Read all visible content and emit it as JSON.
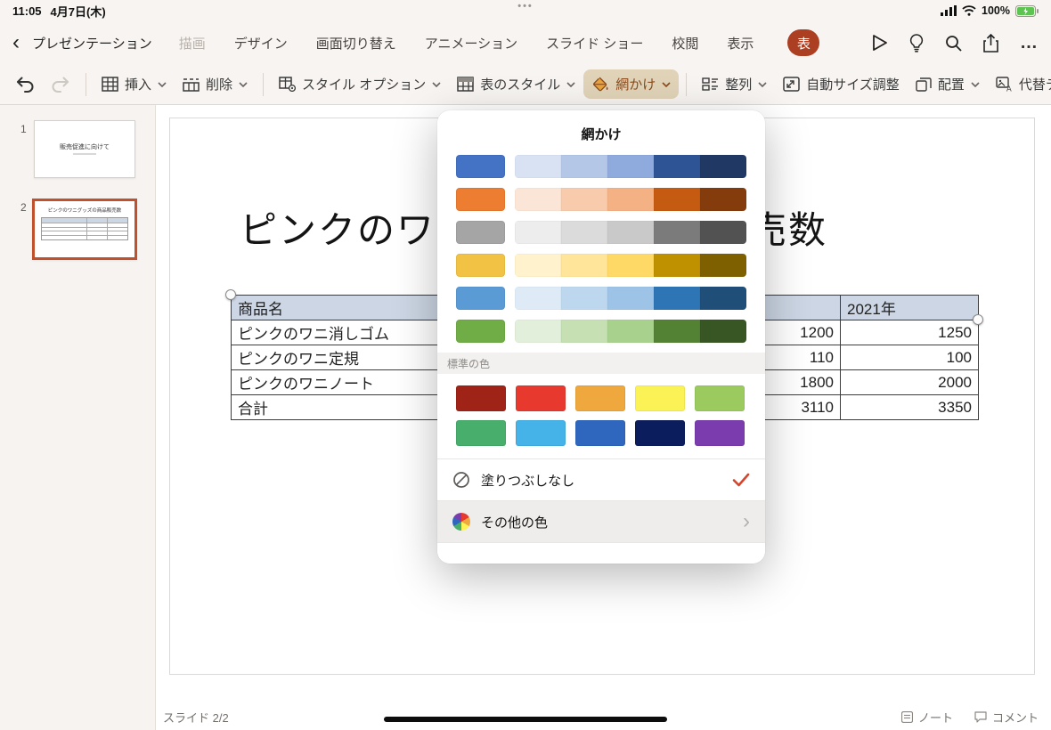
{
  "status": {
    "time": "11:05",
    "date": "4月7日(木)",
    "battery": "100%"
  },
  "titlebar": {
    "doc_title": "プレゼンテーション",
    "tabs": [
      "描画",
      "デザイン",
      "画面切り替え",
      "アニメーション",
      "スライド ショー",
      "校閲",
      "表示"
    ],
    "contextual_tab": "表"
  },
  "toolbar": {
    "insert": "挿入",
    "delete": "削除",
    "style_options": "スタイル オプション",
    "table_styles": "表のスタイル",
    "shading": "網かけ",
    "align": "整列",
    "autofit": "自動サイズ調整",
    "arrange": "配置",
    "alt_text": "代替テキスト"
  },
  "sidebar": {
    "slides": [
      {
        "num": "1",
        "title": "販売促進に向けて"
      },
      {
        "num": "2",
        "title": "ピンクのワニグッズの商品販売数"
      }
    ]
  },
  "slide": {
    "title": "ピンクのワニグッズの商品販売数",
    "table": {
      "headers": [
        "商品名",
        "",
        "2021年"
      ],
      "rows": [
        [
          "ピンクのワニ消しゴム",
          "1200",
          "1250"
        ],
        [
          "ピンクのワニ定規",
          "110",
          "100"
        ],
        [
          "ピンクのワニノート",
          "1800",
          "2000"
        ],
        [
          "合計",
          "3110",
          "3350"
        ]
      ]
    }
  },
  "popup": {
    "title": "網かけ",
    "theme_colors": [
      {
        "main": "#4472C4",
        "tints": [
          "#D9E2F3",
          "#B4C7E7",
          "#8FAADC",
          "#2F5496",
          "#1F3864"
        ]
      },
      {
        "main": "#ED7D31",
        "tints": [
          "#FBE5D6",
          "#F7CBAC",
          "#F4B183",
          "#C55A11",
          "#843C0C"
        ]
      },
      {
        "main": "#A5A5A5",
        "tints": [
          "#EDEDED",
          "#DBDBDB",
          "#C9C9C9",
          "#7B7B7B",
          "#525252"
        ]
      },
      {
        "main": "#F2C245",
        "tints": [
          "#FFF2CC",
          "#FFE599",
          "#FFD966",
          "#BF9000",
          "#7F6000"
        ]
      },
      {
        "main": "#5B9BD5",
        "tints": [
          "#DEEBF7",
          "#BDD7EE",
          "#9DC3E6",
          "#2E75B6",
          "#1F4E79"
        ]
      },
      {
        "main": "#70AD47",
        "tints": [
          "#E2EFDA",
          "#C6E0B4",
          "#A9D18E",
          "#548235",
          "#375623"
        ]
      }
    ],
    "standard_label": "標準の色",
    "standard_colors": [
      [
        "#A02318",
        "#E8392E",
        "#EFA83D",
        "#FBF356",
        "#9BCB5F"
      ],
      [
        "#47AE6C",
        "#45B2E8",
        "#2F66BE",
        "#0B1D5C",
        "#7B3DAD"
      ]
    ],
    "no_fill": "塗りつぶしなし",
    "more_colors": "その他の色",
    "check_color": "#D2452E"
  },
  "footer": {
    "slide_counter": "スライド 2/2",
    "notes": "ノート",
    "comments": "コメント"
  }
}
